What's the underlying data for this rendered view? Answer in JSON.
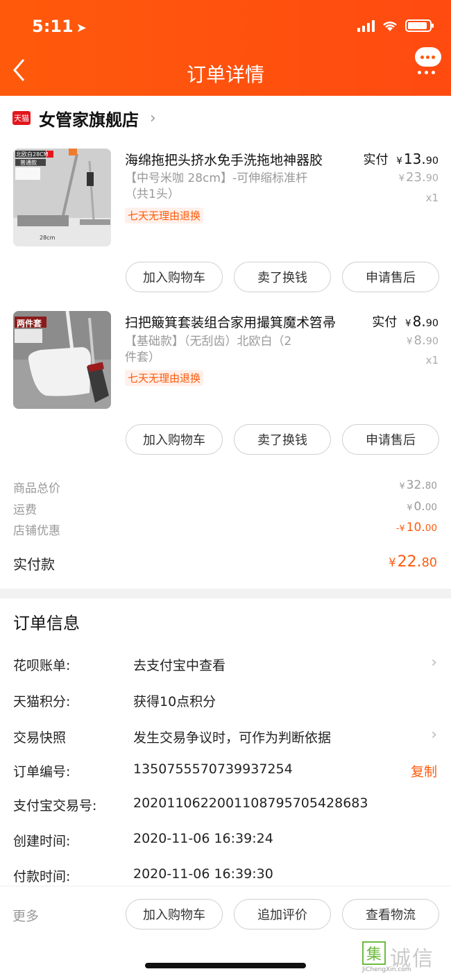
{
  "status_bar": {
    "time": "5:11",
    "battery_level": 0.9
  },
  "header": {
    "title": "订单详情"
  },
  "store": {
    "badge": "天猫",
    "name": "女管家旗舰店"
  },
  "products": [
    {
      "title": "海绵拖把头挤水免手洗拖地神器胶",
      "sku_line1": "【中号米咖 28cm】-可伸缩标准杆",
      "sku_line2": "（共1头）",
      "tag": "七天无理由退换",
      "paid_label": "实付",
      "paid_currency": "¥",
      "paid_int": "13.",
      "paid_dec": "90",
      "orig_currency": "¥",
      "orig_int": "23.",
      "orig_dec": "90",
      "qty": "x1",
      "thumb_label1": "北欧白28CM",
      "thumb_label2": "普通款",
      "thumb_label3": "28cm",
      "buttons": [
        "加入购物车",
        "卖了换钱",
        "申请售后"
      ]
    },
    {
      "title": "扫把簸箕套装组合家用撮箕魔术笤帚",
      "sku_line1": "【基础款】（无刮齿）北欧白（2",
      "sku_line2": "件套）",
      "tag": "七天无理由退换",
      "paid_label": "实付",
      "paid_currency": "¥",
      "paid_int": "8.",
      "paid_dec": "90",
      "orig_currency": "¥",
      "orig_int": "8.",
      "orig_dec": "90",
      "qty": "x1",
      "thumb_label1": "两件套",
      "buttons": [
        "加入购物车",
        "卖了换钱",
        "申请售后"
      ]
    }
  ],
  "summary": {
    "goods_total_label": "商品总价",
    "goods_total_currency": "¥",
    "goods_total_int": "32.",
    "goods_total_dec": "80",
    "shipping_label": "运费",
    "shipping_currency": "¥",
    "shipping_int": "0.",
    "shipping_dec": "00",
    "discount_label": "店铺优惠",
    "discount_currency": "-¥",
    "discount_int": "10.",
    "discount_dec": "00",
    "paid_label": "实付款",
    "paid_currency": "¥",
    "paid_int": "22.",
    "paid_dec": "80"
  },
  "order_info": {
    "title": "订单信息",
    "rows": [
      {
        "label": "花呗账单:",
        "value": "去支付宝中查看"
      },
      {
        "label": "天猫积分:",
        "value": "获得10点积分"
      },
      {
        "label": "交易快照",
        "value": "发生交易争议时，可作为判断依据"
      },
      {
        "label": "订单编号:",
        "value": "1350755570739937254",
        "action": "复制"
      },
      {
        "label": "支付宝交易号:",
        "value": "2020110622001108795705428683"
      },
      {
        "label": "创建时间:",
        "value": "2020-11-06 16:39:24"
      },
      {
        "label": "付款时间:",
        "value": "2020-11-06 16:39:30"
      }
    ]
  },
  "bottom_bar": {
    "more": "更多",
    "buttons": [
      "加入购物车",
      "追加评价",
      "查看物流"
    ]
  },
  "watermark": {
    "box": "集",
    "text": "诚信",
    "url": "JiChengXin.com"
  }
}
